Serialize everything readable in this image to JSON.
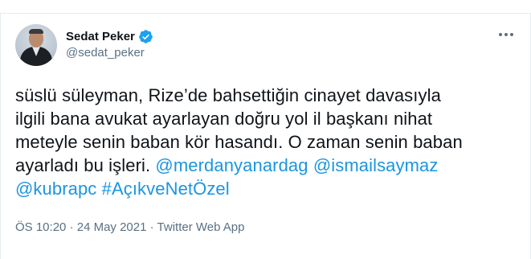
{
  "author": {
    "display_name": "Sedat Peker",
    "handle": "@sedat_peker",
    "verified": true
  },
  "tweet": {
    "line1": "süslü süleyman, Rize’de bahsettiğin cinayet davasıyla",
    "line2": "ilgili bana avukat ayarlayan doğru yol il başkanı nihat",
    "line3": "meteyle senin baban kör hasandı. O zaman senin baban",
    "line4_text": "ayarladı bu işleri.",
    "mention1": "@merdanyanardag",
    "mention2": "@ismailsaymaz",
    "mention3": "@kubrapc",
    "hashtag": "#AçıkveNetÖzel"
  },
  "meta": {
    "time": "ÖS 10:20",
    "separator": "·",
    "date": "24 May 2021",
    "source": "Twitter Web App"
  },
  "colors": {
    "link": "#1b95e0",
    "verified_badge": "#1da1f2",
    "secondary_text": "#5b7083"
  },
  "icons": {
    "more": "more-horizontal-icon",
    "verified": "verified-badge-icon"
  }
}
